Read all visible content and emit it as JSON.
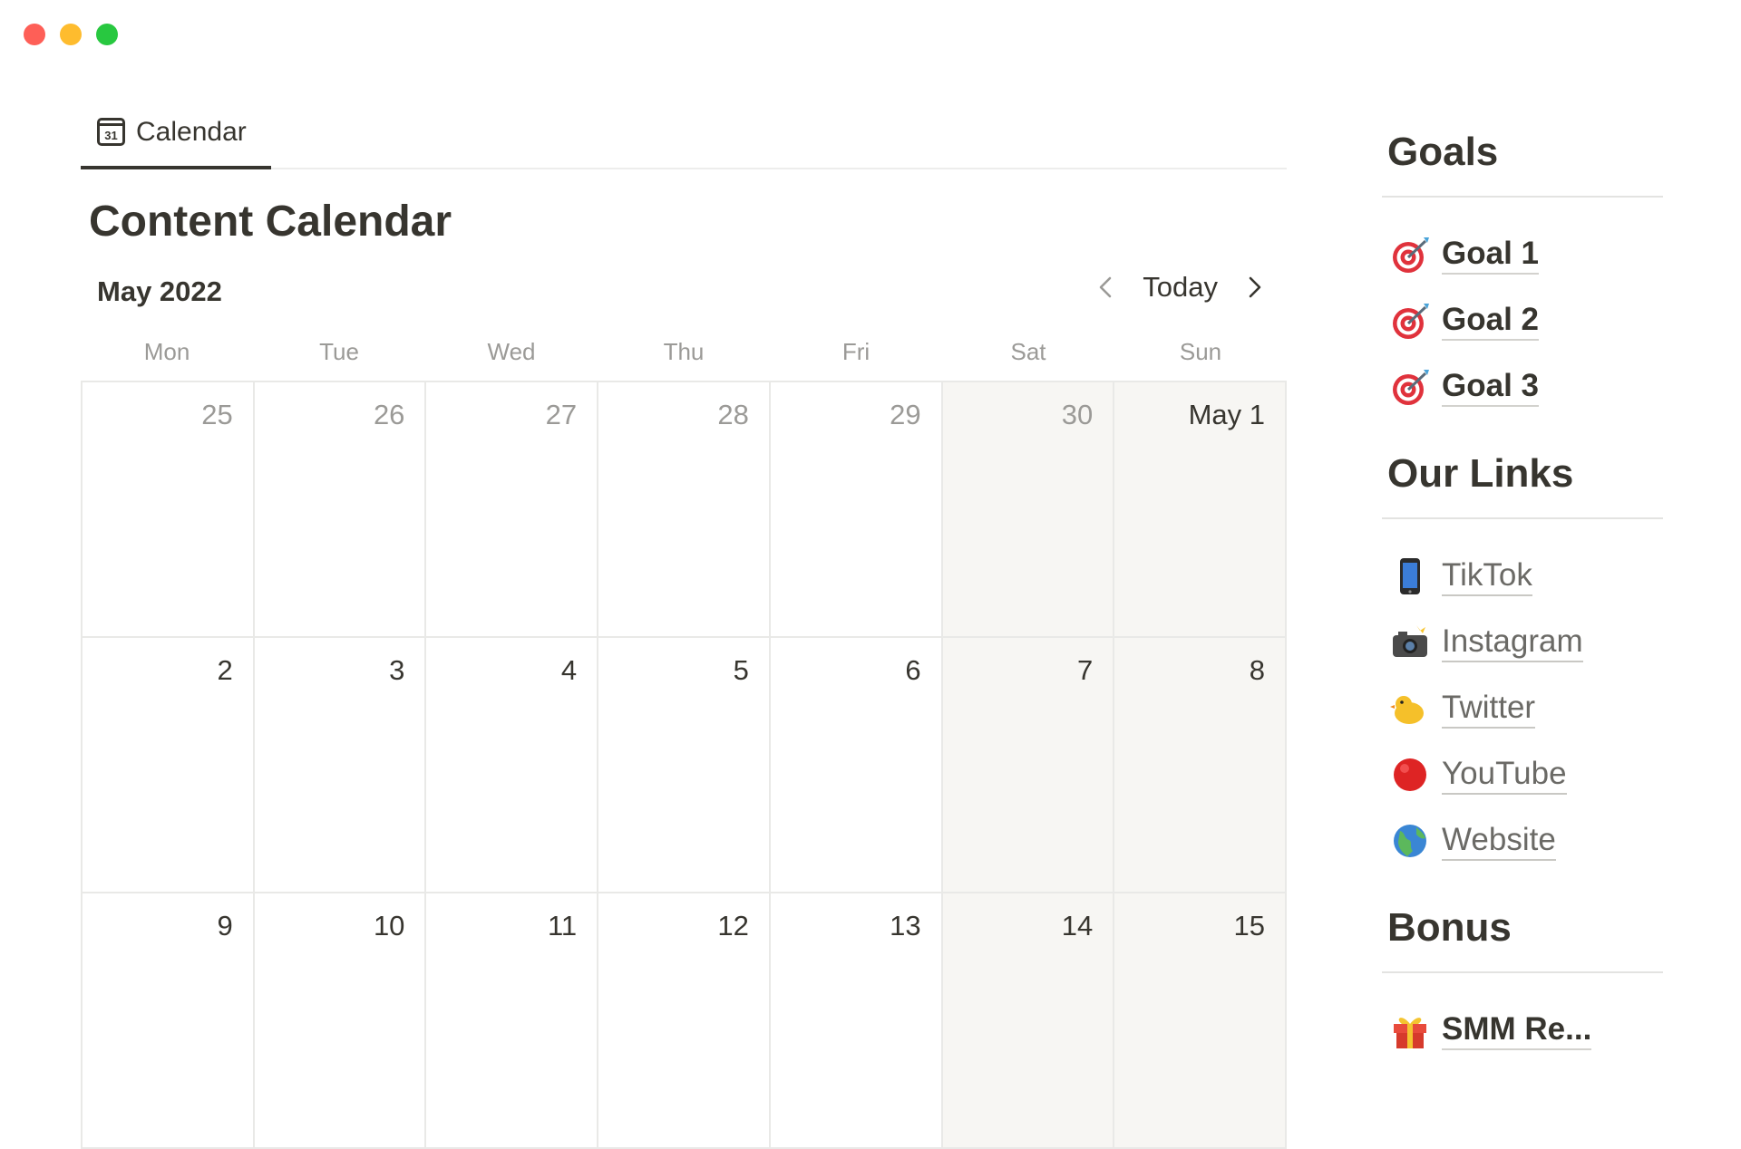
{
  "tab": {
    "label": "Calendar",
    "icon": "calendar-icon",
    "icon_text": "31"
  },
  "page": {
    "title": "Content Calendar"
  },
  "calendar": {
    "month": "May 2022",
    "today_label": "Today",
    "weekdays": [
      "Mon",
      "Tue",
      "Wed",
      "Thu",
      "Fri",
      "Sat",
      "Sun"
    ],
    "weeks": [
      [
        {
          "label": "25",
          "muted": true
        },
        {
          "label": "26",
          "muted": true
        },
        {
          "label": "27",
          "muted": true
        },
        {
          "label": "28",
          "muted": true
        },
        {
          "label": "29",
          "muted": true
        },
        {
          "label": "30",
          "muted": true
        },
        {
          "label": "May 1",
          "muted": false
        }
      ],
      [
        {
          "label": "2"
        },
        {
          "label": "3"
        },
        {
          "label": "4"
        },
        {
          "label": "5"
        },
        {
          "label": "6"
        },
        {
          "label": "7"
        },
        {
          "label": "8"
        }
      ],
      [
        {
          "label": "9"
        },
        {
          "label": "10"
        },
        {
          "label": "11"
        },
        {
          "label": "12"
        },
        {
          "label": "13"
        },
        {
          "label": "14"
        },
        {
          "label": "15"
        }
      ]
    ]
  },
  "sidebar": {
    "goals": {
      "title": "Goals",
      "items": [
        {
          "label": "Goal 1",
          "icon": "target-icon"
        },
        {
          "label": "Goal 2",
          "icon": "target-icon"
        },
        {
          "label": "Goal 3",
          "icon": "target-icon"
        }
      ]
    },
    "links": {
      "title": "Our Links",
      "items": [
        {
          "label": "TikTok",
          "icon": "phone-icon"
        },
        {
          "label": "Instagram",
          "icon": "camera-flash-icon"
        },
        {
          "label": "Twitter",
          "icon": "chick-icon"
        },
        {
          "label": "YouTube",
          "icon": "red-circle-icon"
        },
        {
          "label": "Website",
          "icon": "globe-icon"
        }
      ]
    },
    "bonus": {
      "title": "Bonus",
      "items": [
        {
          "label": "SMM Re...",
          "icon": "gift-icon"
        }
      ]
    }
  },
  "colors": {
    "text": "#37352f",
    "muted": "#9b9a97",
    "weekend_bg": "#f7f6f3",
    "border": "#e9e9e7"
  }
}
